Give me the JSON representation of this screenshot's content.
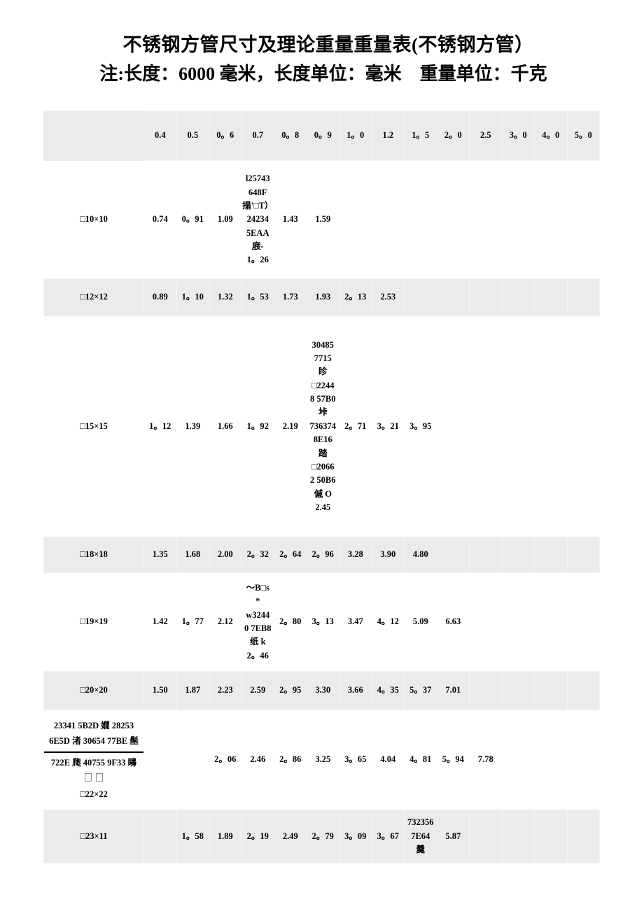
{
  "document": {
    "title": "不锈钢方管尺寸及理论重量重量表(不锈钢方管）",
    "note": "注:长度：6000 毫米，长度单位：毫米　重量单位：千克"
  },
  "table": {
    "corner_header": "",
    "thickness_headers": [
      "0.4",
      "0.5",
      "0。6",
      "0.7",
      "0。8",
      "0。9",
      "1。0",
      "1.2",
      "1。5",
      "2。0",
      "2.5",
      "3。0",
      "4。0",
      "5。0"
    ],
    "rows": [
      {
        "label": "□10×10",
        "shaded": false,
        "cells": [
          "0.74",
          "0。91",
          "1.09",
          "l25743\n648F\n搨'□T）\n24234\n5EAA\n庪-\n1。26",
          "1.43",
          "1.59",
          "",
          "",
          "",
          "",
          "",
          "",
          "",
          ""
        ]
      },
      {
        "label": "□12×12",
        "shaded": true,
        "cells": [
          "0.89",
          "1。10",
          "1.32",
          "1。53",
          "1.73",
          "1.93",
          "2。13",
          "2.53",
          "",
          "",
          "",
          "",
          "",
          ""
        ]
      },
      {
        "label": "□15×15",
        "shaded": false,
        "cells": [
          "1。12",
          "1.39",
          "1.66",
          "1。92",
          "2.19",
          "30485\n7715\n眕\n□2244\n8 57B0\n垰\n736374\n8E16\n踏\n□2066\n2 50B6\n傶 O\n2.45",
          "2。71",
          "3。21",
          "3。95",
          "",
          "",
          "",
          "",
          ""
        ]
      },
      {
        "label": "□18×18",
        "shaded": true,
        "cells": [
          "1.35",
          "1.68",
          "2.00",
          "2。32",
          "2。64",
          "2。96",
          "3.28",
          "3.90",
          "4.80",
          "",
          "",
          "",
          "",
          ""
        ]
      },
      {
        "label": "□19×19",
        "shaded": false,
        "cells": [
          "1.42",
          "1。77",
          "2.12",
          "〜B□s\n*\nw3244\n0 7EB8\n纸 k\n2。46",
          "2。80",
          "3。13",
          "3.47",
          "4。12",
          "5.09",
          "6.63",
          "",
          "",
          "",
          ""
        ]
      },
      {
        "label": "□20×20",
        "shaded": true,
        "cells": [
          "1.50",
          "1.87",
          "2.23",
          "2.59",
          "2。95",
          "3.30",
          "3.66",
          "4。35",
          "5。37",
          "7.01",
          "",
          "",
          "",
          ""
        ]
      },
      {
        "label": "23341 5B2D 嫺 28253\n6E5D 渚 30654 77BE 髬\n722E 爮 40755 9F33 矏\n□□\n□22×22",
        "label_garbled": true,
        "shaded": false,
        "cells": [
          "",
          "",
          "2。06",
          "2.46",
          "2。86",
          "3.25",
          "3。65",
          "4.04",
          "4。81",
          "5。94",
          "7.78",
          "",
          "",
          ""
        ]
      },
      {
        "label": "□23×11",
        "shaded": true,
        "cells": [
          "",
          "1。58",
          "1.89",
          "2。19",
          "2.49",
          "2。79",
          "3。09",
          "3。67",
          "732356\n7E64\n羹",
          "5.87",
          "",
          "",
          "",
          ""
        ]
      }
    ]
  },
  "colors": {
    "page_background": "#ffffff",
    "row_shade": "#ebebeb",
    "grid_line": "#f4f4f4",
    "text": "#000000"
  }
}
